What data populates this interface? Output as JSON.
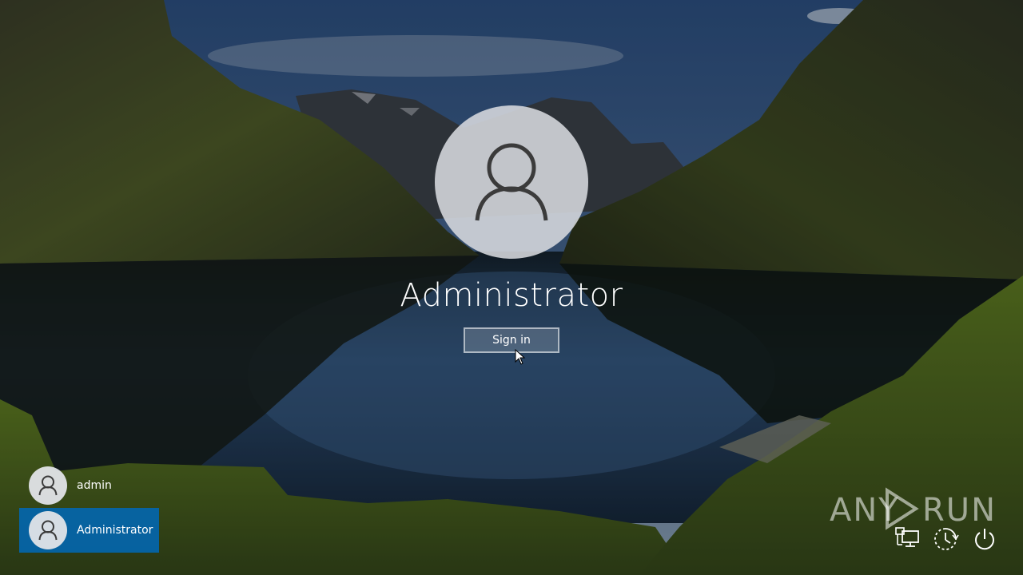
{
  "login": {
    "current_user": "Administrator",
    "sign_in_label": "Sign in"
  },
  "user_list": [
    {
      "name": "admin",
      "selected": false
    },
    {
      "name": "Administrator",
      "selected": true
    }
  ],
  "watermark": {
    "left": "ANY",
    "right": "RUN"
  },
  "tray": [
    {
      "icon": "network-icon"
    },
    {
      "icon": "ease-of-access-icon"
    },
    {
      "icon": "power-icon"
    }
  ],
  "colors": {
    "selected_user_bg": "#0068b8",
    "text": "#ffffff"
  }
}
